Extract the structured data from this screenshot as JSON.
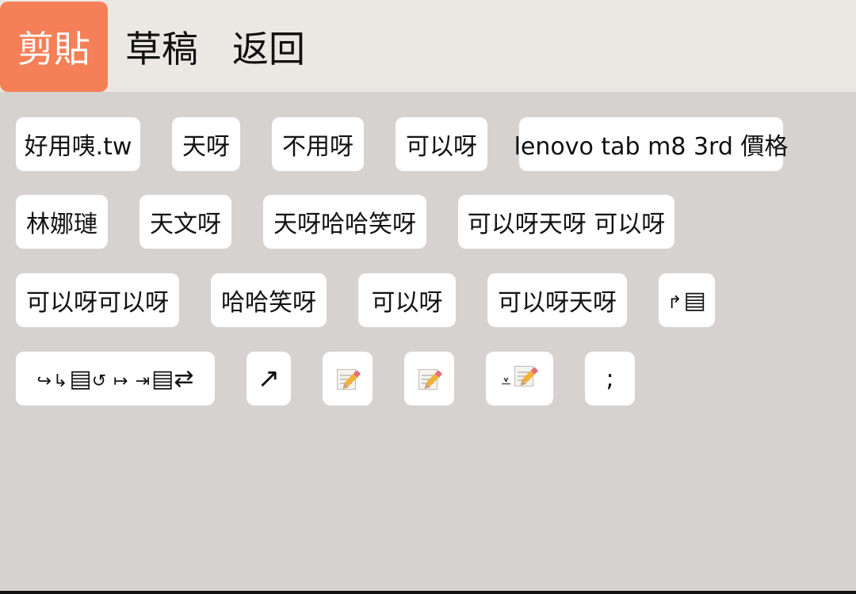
{
  "tabs": {
    "clipboard": "剪貼",
    "drafts": "草稿",
    "back": "返回"
  },
  "chips": {
    "row1": [
      "好用咦.tw",
      "天呀",
      "不用呀",
      "可以呀",
      "lenovo tab m8 3rd 價格"
    ],
    "row2": [
      "林娜璉",
      "天文呀",
      "天呀哈哈笑呀",
      "可以呀天呀 可以呀"
    ],
    "row3": [
      "可以呀可以呀",
      "哈哈笑呀",
      "可以呀",
      "可以呀天呀"
    ],
    "row4_semicolon": ";"
  },
  "icons": {
    "return_list": "return-list-icon",
    "multi_symbol": "symbol-sequence-icon",
    "arrow": "arrow-northeast-icon",
    "memo1": "memo-icon",
    "memo2": "memo-icon",
    "down_memo": "down-memo-icon"
  },
  "colors": {
    "active_tab": "#f57f57",
    "tabbar_bg": "#ebe7e3",
    "content_bg": "#d6d2cf",
    "chip_bg": "#ffffff"
  }
}
